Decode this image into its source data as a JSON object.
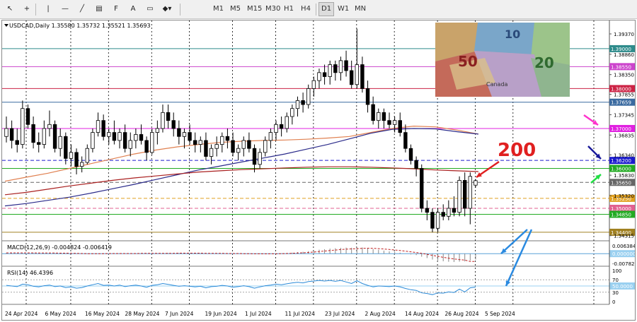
{
  "toolbar": {
    "tools": [
      {
        "name": "cursor-icon",
        "glyph": "↖"
      },
      {
        "name": "crosshair-icon",
        "glyph": "+"
      },
      {
        "name": "vertical-line-icon",
        "glyph": "|"
      },
      {
        "name": "horizontal-line-icon",
        "glyph": "—"
      },
      {
        "name": "trendline-icon",
        "glyph": "╱"
      },
      {
        "name": "channel-icon",
        "glyph": "▤"
      },
      {
        "name": "fibonacci-icon",
        "glyph": "F"
      },
      {
        "name": "text-icon",
        "glyph": "A"
      },
      {
        "name": "rectangle-icon",
        "glyph": "▭"
      },
      {
        "name": "shapes-icon",
        "glyph": "◆▾"
      }
    ],
    "timeframes": [
      "M1",
      "M5",
      "M15",
      "M30",
      "H1",
      "H4",
      "D1",
      "W1",
      "MN"
    ],
    "active_timeframe": "D1"
  },
  "chart_data": [
    {
      "type": "candlestick",
      "title": "USDCAD,Daily  1.35580 1.35732 1.35521 1.35693",
      "symbol": "USDCAD",
      "timeframe": "Daily",
      "ohlc_header": {
        "open": 1.3558,
        "high": 1.35732,
        "low": 1.35521,
        "close": 1.35693
      },
      "ylim": [
        1.3431,
        1.396
      ],
      "y_ticks": [
        1.3937,
        1.3886,
        1.3835,
        1.37855,
        1.37345,
        1.36835,
        1.3634,
        1.3583,
        1.3532,
        1.34315
      ],
      "x_ticks": [
        "24 Apr 2024",
        "6 May 2024",
        "16 May 2024",
        "28 May 2024",
        "7 Jun 2024",
        "19 Jun 2024",
        "1 Jul 2024",
        "11 Jul 2024",
        "23 Jul 2024",
        "2 Aug 2024",
        "14 Aug 2024",
        "26 Aug 2024",
        "5 Sep 2024"
      ],
      "levels": [
        {
          "value": 1.39,
          "label": "1.39000",
          "color": "#2e8b8b",
          "style": "solid"
        },
        {
          "value": 1.3855,
          "label": "1.38550",
          "color": "#cc44cc",
          "style": "solid"
        },
        {
          "value": 1.38,
          "label": "1.38000",
          "color": "#cc2244",
          "style": "solid"
        },
        {
          "value": 1.37659,
          "label": "1.37659",
          "color": "#3a6aa0",
          "style": "solid"
        },
        {
          "value": 1.37,
          "label": "1.37000",
          "color": "#e020e0",
          "style": "solid"
        },
        {
          "value": 1.362,
          "label": "1.36200",
          "color": "#1a1acc",
          "style": "dashed"
        },
        {
          "value": 1.36,
          "label": "1.36000",
          "color": "#22aa22",
          "style": "solid"
        },
        {
          "value": 1.3565,
          "label": "1.35650",
          "color": "#666666",
          "style": "dashed"
        },
        {
          "value": 1.3525,
          "label": "1.35250",
          "color": "#e0a020",
          "style": "dashed"
        },
        {
          "value": 1.35,
          "label": "1.35000",
          "color": "#e06090",
          "style": "dashed"
        },
        {
          "value": 1.3485,
          "label": "1.34850",
          "color": "#22aa22",
          "style": "solid"
        },
        {
          "value": 1.344,
          "label": "1.34400",
          "color": "#a08020",
          "style": "solid"
        }
      ],
      "moving_averages": [
        {
          "name": "MA",
          "color": "#e08050",
          "values": [
            1.3568,
            1.3578,
            1.3588,
            1.36,
            1.3612,
            1.3624,
            1.3636,
            1.3646,
            1.3654,
            1.366,
            1.3665,
            1.3668,
            1.367,
            1.3671,
            1.3673,
            1.3676,
            1.368,
            1.369,
            1.37,
            1.3706,
            1.3704,
            1.3696,
            1.3686
          ]
        },
        {
          "name": "MA",
          "color": "#2a2a8a",
          "values": [
            1.3506,
            1.3512,
            1.352,
            1.3528,
            1.3538,
            1.3549,
            1.356,
            1.3572,
            1.3584,
            1.3596,
            1.3606,
            1.3616,
            1.3626,
            1.3636,
            1.3648,
            1.366,
            1.3674,
            1.3688,
            1.3698,
            1.37,
            1.3699,
            1.3692,
            1.3686
          ]
        },
        {
          "name": "MA",
          "color": "#aa2020",
          "values": [
            1.3534,
            1.354,
            1.3548,
            1.3556,
            1.3563,
            1.357,
            1.3576,
            1.3581,
            1.3586,
            1.3591,
            1.3594,
            1.3597,
            1.3599,
            1.3601,
            1.3603,
            1.3604,
            1.3604,
            1.3603,
            1.3601,
            1.3599,
            1.3596,
            1.3594,
            1.3592
          ]
        }
      ],
      "ohlc": [
        [
          1.368,
          1.373,
          1.3665,
          1.37
        ],
        [
          1.37,
          1.372,
          1.365,
          1.367
        ],
        [
          1.367,
          1.37,
          1.364,
          1.366
        ],
        [
          1.366,
          1.377,
          1.365,
          1.375
        ],
        [
          1.375,
          1.376,
          1.37,
          1.371
        ],
        [
          1.371,
          1.373,
          1.365,
          1.3665
        ],
        [
          1.3665,
          1.369,
          1.364,
          1.366
        ],
        [
          1.366,
          1.372,
          1.365,
          1.37
        ],
        [
          1.37,
          1.3745,
          1.368,
          1.371
        ],
        [
          1.371,
          1.372,
          1.364,
          1.365
        ],
        [
          1.365,
          1.37,
          1.363,
          1.368
        ],
        [
          1.368,
          1.369,
          1.361,
          1.3625
        ],
        [
          1.3625,
          1.366,
          1.3605,
          1.364
        ],
        [
          1.364,
          1.365,
          1.3585,
          1.3605
        ],
        [
          1.3605,
          1.363,
          1.359,
          1.3615
        ],
        [
          1.3615,
          1.366,
          1.361,
          1.365
        ],
        [
          1.365,
          1.37,
          1.364,
          1.369
        ],
        [
          1.369,
          1.374,
          1.368,
          1.372
        ],
        [
          1.372,
          1.3735,
          1.367,
          1.368
        ],
        [
          1.368,
          1.37,
          1.366,
          1.369
        ],
        [
          1.369,
          1.372,
          1.366,
          1.367
        ],
        [
          1.367,
          1.37,
          1.365,
          1.369
        ],
        [
          1.369,
          1.371,
          1.364,
          1.365
        ],
        [
          1.365,
          1.369,
          1.363,
          1.367
        ],
        [
          1.367,
          1.37,
          1.365,
          1.3685
        ],
        [
          1.3685,
          1.371,
          1.366,
          1.367
        ],
        [
          1.367,
          1.368,
          1.362,
          1.364
        ],
        [
          1.364,
          1.37,
          1.3635,
          1.369
        ],
        [
          1.369,
          1.372,
          1.366,
          1.37
        ],
        [
          1.37,
          1.376,
          1.369,
          1.374
        ],
        [
          1.374,
          1.376,
          1.37,
          1.372
        ],
        [
          1.372,
          1.374,
          1.368,
          1.37
        ],
        [
          1.37,
          1.372,
          1.366,
          1.368
        ],
        [
          1.368,
          1.37,
          1.365,
          1.369
        ],
        [
          1.369,
          1.371,
          1.366,
          1.367
        ],
        [
          1.367,
          1.369,
          1.364,
          1.366
        ],
        [
          1.366,
          1.368,
          1.364,
          1.367
        ],
        [
          1.367,
          1.369,
          1.362,
          1.363
        ],
        [
          1.363,
          1.366,
          1.361,
          1.365
        ],
        [
          1.365,
          1.368,
          1.363,
          1.366
        ],
        [
          1.366,
          1.369,
          1.364,
          1.368
        ],
        [
          1.368,
          1.37,
          1.365,
          1.367
        ],
        [
          1.367,
          1.369,
          1.363,
          1.364
        ],
        [
          1.364,
          1.366,
          1.362,
          1.365
        ],
        [
          1.365,
          1.368,
          1.363,
          1.367
        ],
        [
          1.367,
          1.369,
          1.364,
          1.365
        ],
        [
          1.365,
          1.366,
          1.359,
          1.361
        ],
        [
          1.361,
          1.365,
          1.36,
          1.364
        ],
        [
          1.364,
          1.368,
          1.363,
          1.367
        ],
        [
          1.367,
          1.37,
          1.365,
          1.369
        ],
        [
          1.369,
          1.372,
          1.367,
          1.371
        ],
        [
          1.371,
          1.373,
          1.368,
          1.37
        ],
        [
          1.37,
          1.374,
          1.369,
          1.373
        ],
        [
          1.373,
          1.376,
          1.371,
          1.375
        ],
        [
          1.375,
          1.378,
          1.373,
          1.377
        ],
        [
          1.377,
          1.379,
          1.374,
          1.376
        ],
        [
          1.376,
          1.381,
          1.375,
          1.38
        ],
        [
          1.38,
          1.383,
          1.378,
          1.382
        ],
        [
          1.382,
          1.385,
          1.38,
          1.384
        ],
        [
          1.384,
          1.386,
          1.381,
          1.383
        ],
        [
          1.383,
          1.387,
          1.381,
          1.386
        ],
        [
          1.386,
          1.387,
          1.382,
          1.384
        ],
        [
          1.384,
          1.388,
          1.382,
          1.387
        ],
        [
          1.387,
          1.3895,
          1.383,
          1.3845
        ],
        [
          1.3845,
          1.387,
          1.38,
          1.381
        ],
        [
          1.381,
          1.395,
          1.38,
          1.386
        ],
        [
          1.386,
          1.388,
          1.379,
          1.38
        ],
        [
          1.38,
          1.382,
          1.374,
          1.376
        ],
        [
          1.376,
          1.378,
          1.371,
          1.372
        ],
        [
          1.372,
          1.375,
          1.37,
          1.374
        ],
        [
          1.374,
          1.375,
          1.37,
          1.372
        ],
        [
          1.372,
          1.374,
          1.37,
          1.371
        ],
        [
          1.371,
          1.373,
          1.369,
          1.372
        ],
        [
          1.372,
          1.374,
          1.368,
          1.369
        ],
        [
          1.369,
          1.371,
          1.364,
          1.365
        ],
        [
          1.365,
          1.366,
          1.361,
          1.362
        ],
        [
          1.362,
          1.363,
          1.358,
          1.36
        ],
        [
          1.36,
          1.361,
          1.349,
          1.35
        ],
        [
          1.35,
          1.352,
          1.347,
          1.349
        ],
        [
          1.349,
          1.35,
          1.344,
          1.345
        ],
        [
          1.345,
          1.35,
          1.344,
          1.349
        ],
        [
          1.349,
          1.351,
          1.347,
          1.348
        ],
        [
          1.348,
          1.352,
          1.347,
          1.35
        ],
        [
          1.35,
          1.353,
          1.348,
          1.349
        ],
        [
          1.349,
          1.358,
          1.348,
          1.357
        ],
        [
          1.357,
          1.359,
          1.348,
          1.35
        ],
        [
          1.35,
          1.359,
          1.346,
          1.358
        ],
        [
          1.3558,
          1.35732,
          1.35521,
          1.35693
        ]
      ]
    },
    {
      "type": "bar",
      "title": "MACD(12,26,9) -0.004824 -0.006419",
      "y_ticks": [
        "0.006384",
        "0.000000",
        "-0.007827"
      ],
      "ylim": [
        -0.0085,
        0.007
      ],
      "values": [
        0.0007,
        0.0006,
        0.0005,
        0.0006,
        0.0006,
        0.0005,
        0.0004,
        0.0004,
        0.0005,
        0.0004,
        0.0003,
        0.0002,
        0.0001,
        -0.0001,
        -0.0002,
        -0.0002,
        -0.0001,
        0.0001,
        0.0002,
        0.0001,
        0.0001,
        0.0002,
        0.0001,
        0.0001,
        0.0002,
        0.0002,
        0.0001,
        0.0001,
        0.0002,
        0.0004,
        0.0005,
        0.0005,
        0.0004,
        0.0004,
        0.0004,
        0.0003,
        0.0003,
        0.0001,
        0.0,
        0.0,
        0.0001,
        0.0001,
        0.0,
        -0.0001,
        -0.0001,
        -0.0001,
        -0.0003,
        -0.0003,
        -0.0002,
        0.0,
        0.0002,
        0.0003,
        0.0005,
        0.0008,
        0.0012,
        0.0015,
        0.002,
        0.0026,
        0.0032,
        0.0036,
        0.0041,
        0.0044,
        0.0047,
        0.0049,
        0.0048,
        0.0052,
        0.005,
        0.0045,
        0.0037,
        0.0031,
        0.0025,
        0.0019,
        0.0014,
        0.0008,
        0.0001,
        -0.0006,
        -0.0012,
        -0.0025,
        -0.0036,
        -0.0048,
        -0.0055,
        -0.0062,
        -0.0066,
        -0.0068,
        -0.0065,
        -0.0063,
        -0.0056,
        -0.0048
      ],
      "signal": [
        0.0006,
        0.0006,
        0.0006,
        0.0006,
        0.0006,
        0.0006,
        0.0005,
        0.0005,
        0.0005,
        0.0005,
        0.0004,
        0.0004,
        0.0003,
        0.0002,
        0.0001,
        0.0,
        0.0,
        0.0,
        0.0,
        0.0001,
        0.0001,
        0.0001,
        0.0001,
        0.0001,
        0.0001,
        0.0002,
        0.0002,
        0.0002,
        0.0002,
        0.0002,
        0.0003,
        0.0003,
        0.0004,
        0.0004,
        0.0004,
        0.0004,
        0.0004,
        0.0003,
        0.0003,
        0.0002,
        0.0002,
        0.0001,
        0.0001,
        0.0001,
        0.0,
        0.0,
        -0.0001,
        -0.0001,
        -0.0002,
        -0.0001,
        -0.0001,
        0.0,
        0.0001,
        0.0003,
        0.0005,
        0.0007,
        0.001,
        0.0013,
        0.0017,
        0.0021,
        0.0025,
        0.0029,
        0.0033,
        0.0036,
        0.0039,
        0.0041,
        0.0043,
        0.0044,
        0.0043,
        0.0041,
        0.0038,
        0.0034,
        0.003,
        0.0025,
        0.002,
        0.0015,
        0.0009,
        0.0002,
        -0.0006,
        -0.0014,
        -0.0022,
        -0.003,
        -0.0037,
        -0.0043,
        -0.0048,
        -0.0052,
        -0.0063,
        -0.0064
      ]
    },
    {
      "type": "line",
      "title": "RSI(14) 46.4396",
      "y_ticks": [
        "100",
        "70",
        "50.0000",
        "30",
        "0"
      ],
      "ylim": [
        0,
        100
      ],
      "values": [
        52,
        50,
        48,
        56,
        54,
        49,
        47,
        51,
        53,
        48,
        50,
        45,
        47,
        43,
        45,
        50,
        54,
        58,
        52,
        53,
        50,
        53,
        48,
        51,
        53,
        50,
        46,
        52,
        54,
        58,
        55,
        52,
        49,
        51,
        49,
        47,
        49,
        44,
        48,
        49,
        52,
        50,
        46,
        48,
        51,
        48,
        43,
        47,
        51,
        53,
        56,
        54,
        57,
        60,
        62,
        60,
        64,
        66,
        68,
        66,
        68,
        65,
        68,
        63,
        58,
        67,
        58,
        52,
        47,
        50,
        49,
        48,
        50,
        47,
        42,
        38,
        36,
        28,
        26,
        22,
        28,
        27,
        31,
        29,
        40,
        31,
        44,
        46.4396
      ]
    }
  ],
  "annotations": {
    "label_200": "200",
    "arrow_colors": {
      "red": "#e02020",
      "magenta": "#ff33cc",
      "navy": "#1a1a9a",
      "green": "#22dd44",
      "blue": "#2a8ae0"
    }
  },
  "banknotes": {
    "note_50": "50",
    "note_20": "20",
    "note_10": "10",
    "canada": "Canada"
  }
}
